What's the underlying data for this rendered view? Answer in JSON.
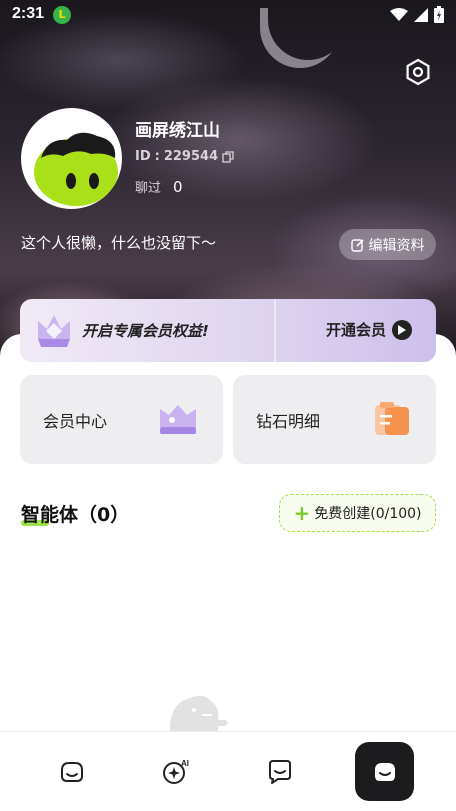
{
  "status_bar": {
    "time": "2:31",
    "app_badge": "L",
    "icons": [
      "wifi-icon",
      "signal-icon",
      "battery-icon"
    ]
  },
  "profile": {
    "name": "画屏绣江山",
    "id_label": "ID",
    "id_value": "229544",
    "chat_label": "聊过",
    "chat_count": "0",
    "bio": "这个人很懒，什么也没留下～",
    "edit_label": "编辑资料"
  },
  "vip_banner": {
    "title": "开启专属会员权益!",
    "action": "开通会员"
  },
  "cards": [
    {
      "label": "会员中心",
      "icon": "crown-icon"
    },
    {
      "label": "钻石明细",
      "icon": "clipboard-icon"
    }
  ],
  "agents": {
    "title": "智能体（0）",
    "create_label": "免费创建(0/100)"
  },
  "tab_bar": {
    "items": [
      {
        "icon": "home-face-icon",
        "active": false
      },
      {
        "icon": "ai-sparkle-icon",
        "active": false
      },
      {
        "icon": "message-icon",
        "active": false
      },
      {
        "icon": "profile-face-icon",
        "active": true
      }
    ]
  },
  "colors": {
    "accent_green": "#9ee24a",
    "tab_active_bg": "#1c1c1e",
    "card_bg": "#eeeef0"
  }
}
